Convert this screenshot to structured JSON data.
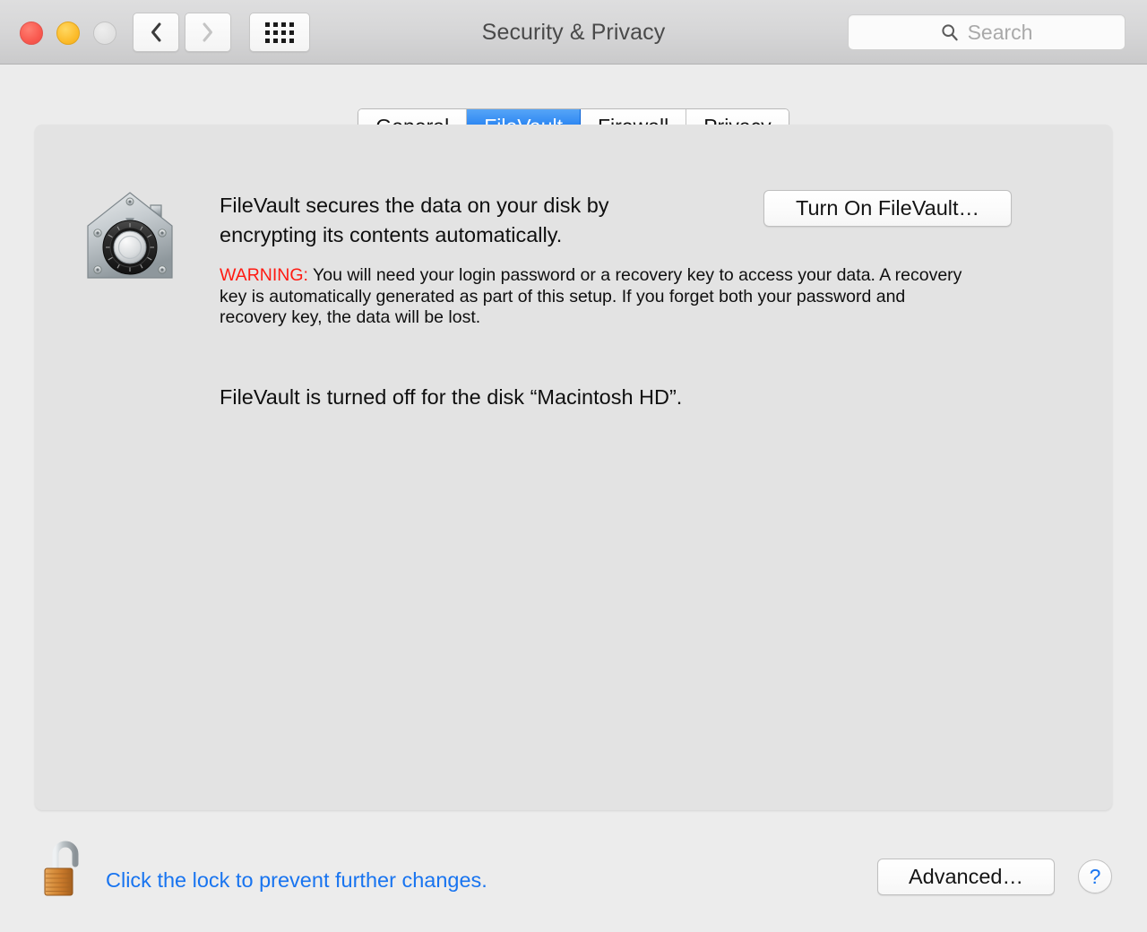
{
  "window": {
    "title": "Security & Privacy",
    "traffic_lights": [
      "close",
      "minimize",
      "zoom"
    ]
  },
  "toolbar": {
    "back_icon": "chevron-left-icon",
    "forward_icon": "chevron-right-icon",
    "grid_icon": "show-all-grid-icon",
    "search": {
      "icon": "search-icon",
      "placeholder": "Search",
      "value": ""
    }
  },
  "tabs": [
    {
      "label": "General",
      "selected": false
    },
    {
      "label": "FileVault",
      "selected": true
    },
    {
      "label": "Firewall",
      "selected": false
    },
    {
      "label": "Privacy",
      "selected": false
    }
  ],
  "filevault": {
    "icon": "filevault-safe-house-icon",
    "description": "FileVault secures the data on your disk by encrypting its contents automatically.",
    "warning_label": "WARNING:",
    "warning_text": " You will need your login password or a recovery key to access your data. A recovery key is automatically generated as part of this setup. If you forget both your password and recovery key, the data will be lost.",
    "status": "FileVault is turned off for the disk “Macintosh HD”.",
    "turn_on_label": "Turn On FileVault…"
  },
  "footer": {
    "lock_icon": "unlocked-padlock-icon",
    "lock_text": "Click the lock to prevent further changes.",
    "advanced_label": "Advanced…",
    "help_label": "?"
  },
  "colors": {
    "accent_blue": "#1874f0",
    "tab_selected_top": "#56a5f7",
    "tab_selected_bottom": "#0b6ae9",
    "warning_red": "#ff1a12",
    "window_bg": "#ececec",
    "panel_bg": "#e3e3e3",
    "title_text": "#4a4a4a"
  }
}
